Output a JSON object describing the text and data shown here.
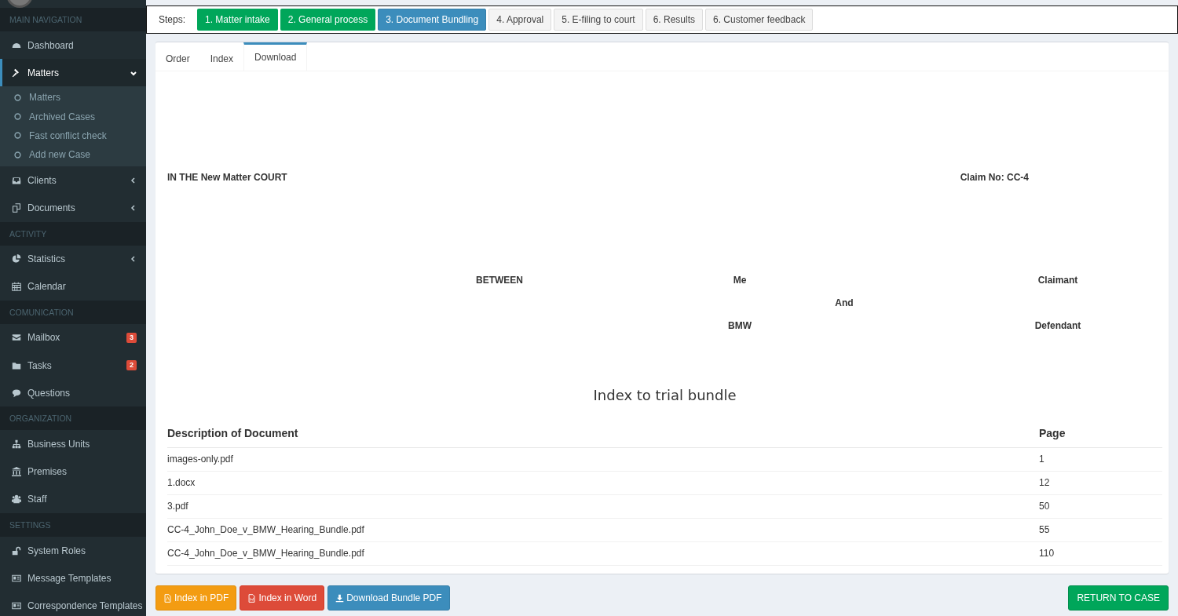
{
  "sidebar": {
    "sections": [
      {
        "header": "MAIN NAVIGATION",
        "items": [
          {
            "label": "Dashboard",
            "selected": false
          },
          {
            "label": "Matters",
            "selected": true,
            "expanded": true,
            "children": [
              {
                "label": "Matters"
              },
              {
                "label": "Archived Cases"
              },
              {
                "label": "Fast conflict check"
              },
              {
                "label": "Add new Case"
              }
            ]
          },
          {
            "label": "Clients",
            "selected": false,
            "expanded": false
          },
          {
            "label": "Documents",
            "selected": false,
            "expanded": false
          }
        ]
      },
      {
        "header": "ACTIVITY",
        "items": [
          {
            "label": "Statistics",
            "selected": false,
            "expanded": false
          },
          {
            "label": "Calendar",
            "selected": false
          }
        ]
      },
      {
        "header": "COMUNICATION",
        "items": [
          {
            "label": "Mailbox",
            "selected": false,
            "badge": "3"
          },
          {
            "label": "Tasks",
            "selected": false,
            "badge": "2"
          },
          {
            "label": "Questions",
            "selected": false
          }
        ]
      },
      {
        "header": "ORGANIZATION",
        "items": [
          {
            "label": "Business Units",
            "selected": false
          },
          {
            "label": "Premises",
            "selected": false
          },
          {
            "label": "Staff",
            "selected": false
          }
        ]
      },
      {
        "header": "SETTINGS",
        "items": [
          {
            "label": "System Roles",
            "selected": false
          },
          {
            "label": "Message Templates",
            "selected": false
          },
          {
            "label": "Correspondence Templates",
            "selected": false
          }
        ]
      }
    ]
  },
  "steps": {
    "label": "Steps:",
    "items": [
      {
        "label": "1. Matter intake",
        "completed": true,
        "selected": false
      },
      {
        "label": "2. General process",
        "completed": true,
        "selected": false
      },
      {
        "label": "3. Document Bundling",
        "completed": false,
        "selected": true
      },
      {
        "label": "4. Approval",
        "completed": false,
        "selected": false
      },
      {
        "label": "5. E-filing to court",
        "completed": false,
        "selected": false
      },
      {
        "label": "6. Results",
        "completed": false,
        "selected": false
      },
      {
        "label": "6. Customer feedback",
        "completed": false,
        "selected": false
      }
    ]
  },
  "tabs": [
    {
      "label": "Order",
      "selected": false
    },
    {
      "label": "Index",
      "selected": false
    },
    {
      "label": "Download",
      "selected": true
    }
  ],
  "document": {
    "court": "IN THE New Matter COURT",
    "claim_no": "Claim No: CC-4",
    "parties": {
      "between": "BETWEEN",
      "claimant": "Me",
      "claimant_role": "Claimant",
      "and": "And",
      "defendant": "BMW",
      "defendant_role": "Defendant"
    },
    "title": "Index to trial bundle",
    "table": {
      "columns": [
        "Description of Document",
        "Page"
      ],
      "rows": [
        [
          "images-only.pdf",
          "1"
        ],
        [
          "1.docx",
          "12"
        ],
        [
          "3.pdf",
          "50"
        ],
        [
          "CC-4_John_Doe_v_BMW_Hearing_Bundle.pdf",
          "55"
        ],
        [
          "CC-4_John_Doe_v_BMW_Hearing_Bundle.pdf",
          "110"
        ]
      ]
    }
  },
  "actions": [
    {
      "label": "Index in PDF",
      "kind": "pdf"
    },
    {
      "label": "Index in Word",
      "kind": "word"
    },
    {
      "label": "Download Bundle PDF",
      "kind": "download"
    }
  ],
  "return_button": "RETURN TO CASE"
}
